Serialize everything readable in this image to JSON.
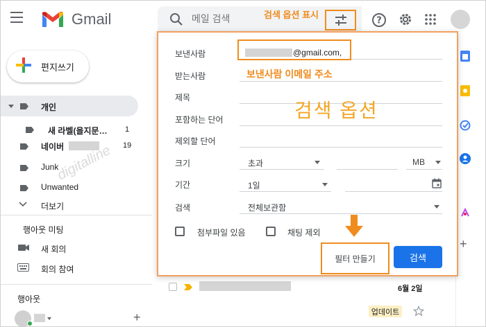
{
  "header": {
    "brand": "Gmail",
    "search_placeholder": "메일 검색",
    "search_options_annotation": "검색 옵션 표시"
  },
  "sidebar": {
    "compose_label": "편지쓰기",
    "personal": "개인",
    "new_label": "새 라벨(을지문…",
    "new_label_count": "1",
    "naver": "네이버",
    "naver_count": "19",
    "junk": "Junk",
    "unwanted": "Unwanted",
    "more": "더보기",
    "meet_heading": "행아웃 미팅",
    "new_meeting": "새 회의",
    "join_meeting": "회의 참여",
    "hangouts_heading": "행아웃",
    "add_label": "+"
  },
  "search_options": {
    "from_label": "보낸사람",
    "from_value": "@gmail.com,",
    "from_annotation": "보낸사람 이메일 주소",
    "to_label": "받는사람",
    "subject_label": "제목",
    "has_words_label": "포함하는 단어",
    "exclude_words_label": "제외할 단어",
    "panel_annotation": "검색 옵션",
    "size_label": "크기",
    "size_operator": "초과",
    "size_unit": "MB",
    "date_label": "기간",
    "date_value": "1일",
    "search_scope_label": "검색",
    "search_scope_value": "전체보관함",
    "has_attachment": "첨부파일 있음",
    "exclude_chats": "채팅 제외",
    "create_filter": "필터 만들기",
    "search_button": "검색"
  },
  "email_list": {
    "row_date": "6월 2일",
    "update_badge": "업데이트"
  },
  "watermark": "digitalline",
  "colors": {
    "accent_orange": "#f08c1e",
    "primary_blue": "#1a73e8"
  }
}
